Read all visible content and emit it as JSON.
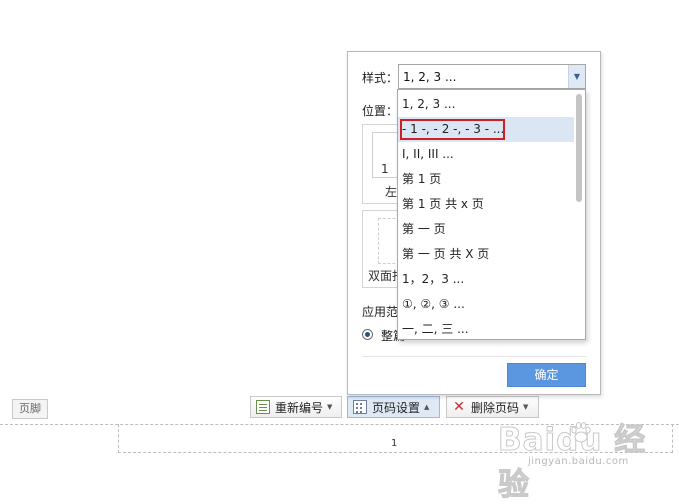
{
  "dialog": {
    "style_label": "样式：",
    "style_value": "1, 2, 3 ...",
    "position_label": "位置：",
    "preview_num": "1",
    "preview_side_label": "左",
    "duplex_label": "双面打",
    "apply_label": "应用范",
    "apply_option_label": "整篇",
    "ok_label": "确定"
  },
  "dropdown": {
    "items": [
      "1, 2, 3 ...",
      "- 1 -, - 2 -, - 3 - ...",
      "I, II, III ...",
      "第 1 页",
      "第 1 页 共 x 页",
      "第 一 页",
      "第 一 页 共 X 页",
      "1，2，3 ...",
      "①, ②, ③ ...",
      "一, 二, 三 ..."
    ],
    "hovered_index": 1,
    "highlight_color": "#cc1f26",
    "hover_color": "#dbe6f5"
  },
  "toolbar": {
    "renumber_label": "重新编号",
    "page_setting_label": "页码设置",
    "delete_label": "删除页码"
  },
  "footer": {
    "tag_label": "页脚",
    "page_number": "1"
  },
  "watermark": {
    "brand": "Baidu 经验",
    "url": "jingyan.baidu.com"
  },
  "colors": {
    "accent": "#5b97e0",
    "highlight_box": "#cc1f26"
  }
}
